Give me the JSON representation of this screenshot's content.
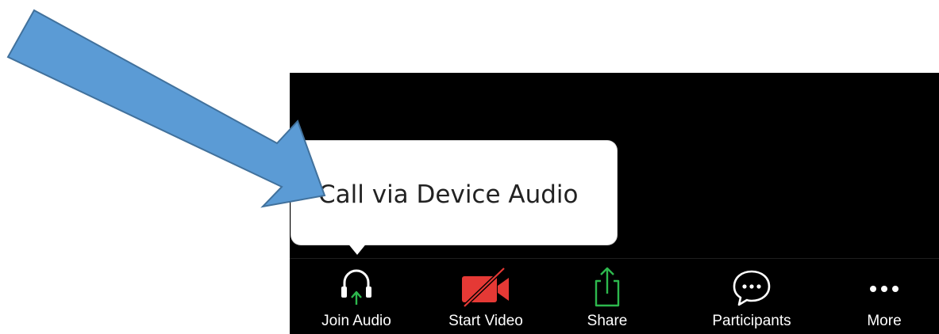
{
  "tooltip": {
    "text": "Call via Device Audio"
  },
  "toolbar": {
    "join_audio_label": "Join Audio",
    "start_video_label": "Start Video",
    "share_label": "Share",
    "participants_label": "Participants",
    "more_label": "More"
  },
  "icons": {
    "join_audio": "headphones-icon",
    "start_video": "video-off-icon",
    "share": "share-icon",
    "participants": "chat-bubble-icon",
    "more": "more-dots-icon",
    "annotation": "pointer-arrow"
  },
  "colors": {
    "app_background": "#000000",
    "label_text": "#ffffff",
    "accent_green": "#2db84d",
    "video_off_red": "#e53935",
    "tooltip_background": "#ffffff",
    "annotation_arrow_fill": "#5b9bd5",
    "annotation_arrow_stroke": "#41719c"
  }
}
